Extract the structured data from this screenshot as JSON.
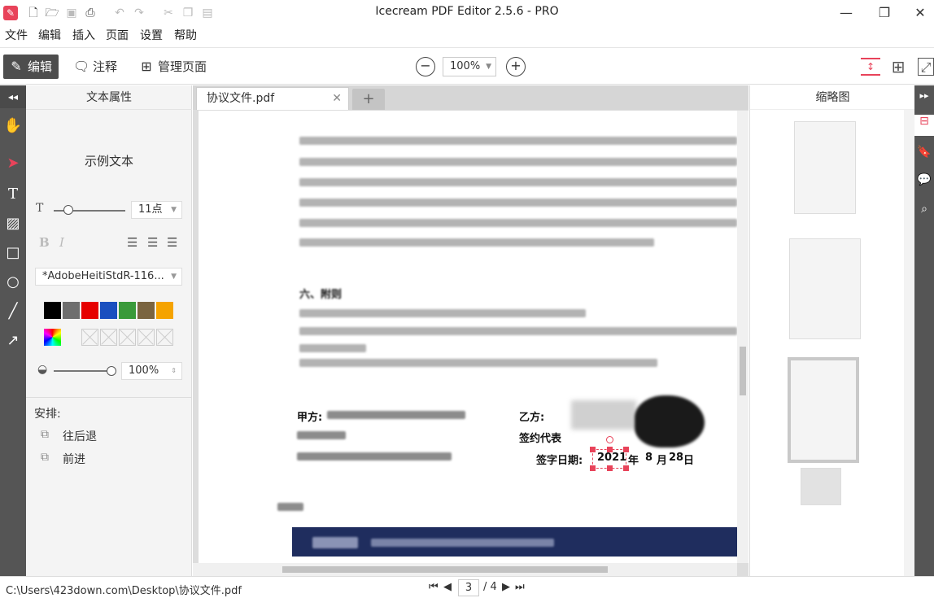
{
  "window": {
    "title": "Icecream PDF Editor 2.5.6 - PRO"
  },
  "menu": [
    "文件",
    "编辑",
    "插入",
    "页面",
    "设置",
    "帮助"
  ],
  "toolbar": {
    "edit": "编辑",
    "annotate": "注释",
    "manage_pages": "管理页面",
    "zoom": "100%"
  },
  "props": {
    "header": "文本属性",
    "sample_text": "示例文本",
    "font_size": "11点",
    "font_name": "*AdobeHeitiStdR-116...",
    "opacity": "100%",
    "arrange_label": "安排:",
    "send_back": "往后退",
    "bring_forward": "前进",
    "colors": [
      "#000000",
      "#6e6e6e",
      "#e60000",
      "#1a4fbf",
      "#3a9a3a",
      "#7a6440",
      "#f5a300"
    ]
  },
  "tabs": {
    "file": "协议文件.pdf",
    "new_tab": "+"
  },
  "document": {
    "section_label": "六、附则",
    "party_a": "甲方:",
    "party_b": "乙方:",
    "rep_b": "签约代表",
    "sign_date_b": "签字日期:",
    "date_year": "2021",
    "date_year_unit": "年",
    "date_month": "8",
    "date_month_unit": "月",
    "date_day": "28",
    "date_day_unit": "日"
  },
  "thumbs": {
    "header": "缩略图"
  },
  "status": {
    "path": "C:\\Users\\423down.com\\Desktop\\协议文件.pdf",
    "current_page": "3",
    "total_pages": "/ 4"
  }
}
